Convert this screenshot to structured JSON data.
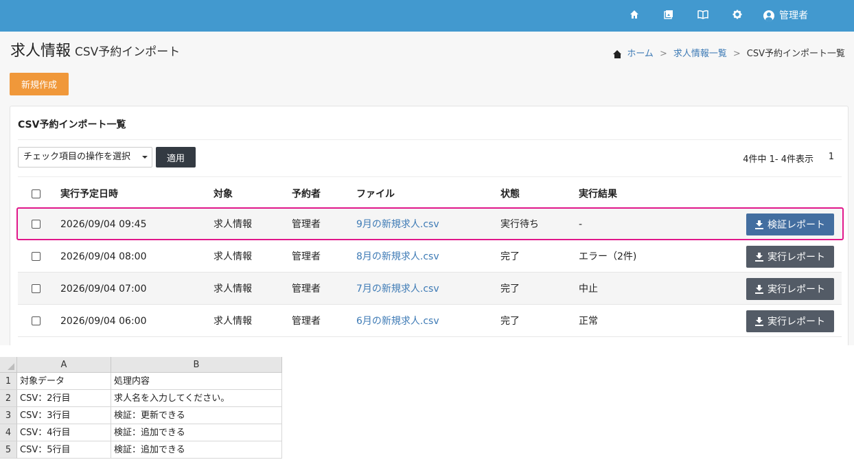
{
  "topbar": {
    "icons": [
      "home-icon",
      "gallery-icon",
      "book-icon",
      "gear-icon"
    ],
    "user_label": "管理者"
  },
  "header": {
    "title": "求人情報",
    "subtitle": "CSV予約インポート"
  },
  "breadcrumb": {
    "home": "ホーム",
    "separator": ">",
    "list": "求人情報一覧",
    "current": "CSV予約インポート一覧"
  },
  "actions": {
    "new_label": "新規作成"
  },
  "card": {
    "title": "CSV予約インポート一覧",
    "bulk_select": "チェック項目の操作を選択",
    "apply_label": "適用",
    "count": "4件中 1- 4件表示",
    "page": "1",
    "columns": {
      "scheduled": "実行予定日時",
      "target": "対象",
      "reserver": "予約者",
      "file": "ファイル",
      "status": "状態",
      "result": "実行結果"
    },
    "rows": [
      {
        "scheduled": "2026/09/04 09:45",
        "target": "求人情報",
        "reserver": "管理者",
        "file": "9月の新規求人.csv",
        "status": "実行待ち",
        "result": "-",
        "button": "検証レポート"
      },
      {
        "scheduled": "2026/09/04 08:00",
        "target": "求人情報",
        "reserver": "管理者",
        "file": "8月の新規求人.csv",
        "status": "完了",
        "result": "エラー（2件)",
        "button": "実行レポート"
      },
      {
        "scheduled": "2026/09/04 07:00",
        "target": "求人情報",
        "reserver": "管理者",
        "file": "7月の新規求人.csv",
        "status": "完了",
        "result": "中止",
        "button": "実行レポート"
      },
      {
        "scheduled": "2026/09/04 06:00",
        "target": "求人情報",
        "reserver": "管理者",
        "file": "6月の新規求人.csv",
        "status": "完了",
        "result": "正常",
        "button": "実行レポート"
      }
    ]
  },
  "sheet": {
    "col_headers": [
      "A",
      "B"
    ],
    "row_headers": [
      "1",
      "2",
      "3",
      "4",
      "5"
    ],
    "rows": [
      [
        "対象データ",
        "処理内容"
      ],
      [
        "CSV：2行目",
        "求人名を入力してください。"
      ],
      [
        "CSV：3行目",
        "検証：更新できる"
      ],
      [
        "CSV：4行目",
        "検証：追加できる"
      ],
      [
        "CSV：5行目",
        "検証：追加できる"
      ]
    ]
  },
  "colors": {
    "topbar": "#4299cf",
    "new_button": "#f0983a",
    "verify_button": "#436ea0",
    "exec_button": "#535b66",
    "highlight": "#e0168a",
    "link": "#3d7ab5"
  }
}
